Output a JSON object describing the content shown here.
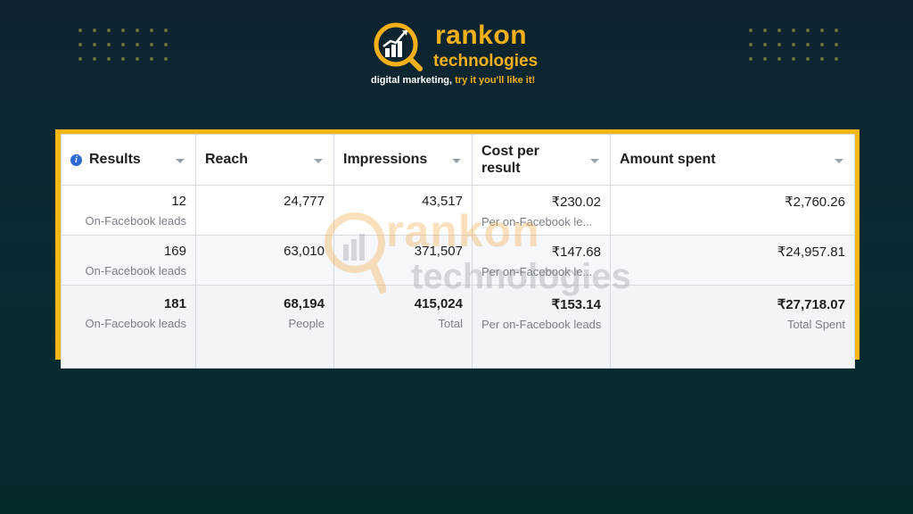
{
  "brand": {
    "name": "rankon",
    "subtitle": "technologies",
    "tagline_prefix": "digital marketing, ",
    "tagline_highlight": "try it you'll like it!",
    "accent_color": "#f3b019"
  },
  "watermark": {
    "line1": "rankon",
    "line2": "technologies"
  },
  "table": {
    "headers": {
      "results": "Results",
      "reach": "Reach",
      "impressions": "Impressions",
      "cost_per_result": "Cost per result",
      "amount_spent": "Amount spent"
    },
    "rows": [
      {
        "results": "12",
        "results_sub": "On-Facebook leads",
        "reach": "24,777",
        "impressions": "43,517",
        "cost": "₹230.02",
        "cost_sub": "Per on-Facebook le...",
        "amount": "₹2,760.26"
      },
      {
        "results": "169",
        "results_sub": "On-Facebook leads",
        "reach": "63,010",
        "impressions": "371,507",
        "cost": "₹147.68",
        "cost_sub": "Per on-Facebook le...",
        "amount": "₹24,957.81"
      }
    ],
    "total": {
      "results": "181",
      "results_sub": "On-Facebook leads",
      "reach": "68,194",
      "reach_sub": "People",
      "impressions": "415,024",
      "impressions_sub": "Total",
      "cost": "₹153.14",
      "cost_sub": "Per on-Facebook leads",
      "amount": "₹27,718.07",
      "amount_sub": "Total Spent"
    }
  },
  "colors": {
    "frame": "#f6b715",
    "info_icon": "#2d6bd2"
  }
}
